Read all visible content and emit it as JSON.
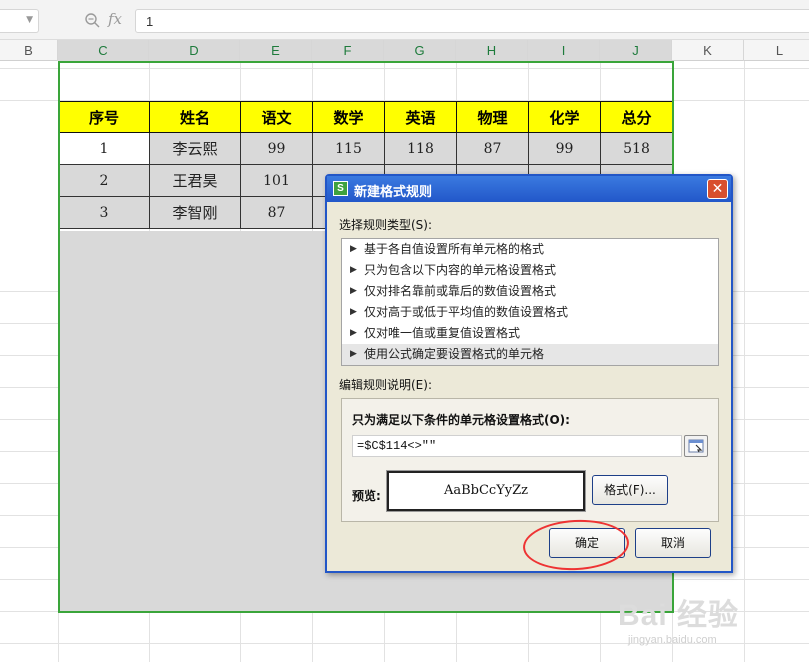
{
  "formula_bar": {
    "formula_value": "1"
  },
  "columns": [
    "B",
    "C",
    "D",
    "E",
    "F",
    "G",
    "H",
    "I",
    "J",
    "K",
    "L"
  ],
  "table": {
    "headers": [
      "序号",
      "姓名",
      "语文",
      "数学",
      "英语",
      "物理",
      "化学",
      "总分"
    ],
    "rows": [
      [
        "1",
        "李云熙",
        "99",
        "115",
        "118",
        "87",
        "99",
        "518"
      ],
      [
        "2",
        "王君昊",
        "101",
        "",
        "",
        "",
        "",
        ""
      ],
      [
        "3",
        "李智刚",
        "87",
        "",
        "",
        "",
        "",
        ""
      ]
    ]
  },
  "dialog": {
    "title": "新建格式规则",
    "rule_type_label": "选择规则类型(S):",
    "rule_types": [
      "基于各自值设置所有单元格的格式",
      "只为包含以下内容的单元格设置格式",
      "仅对排名靠前或靠后的数值设置格式",
      "仅对高于或低于平均值的数值设置格式",
      "仅对唯一值或重复值设置格式",
      "使用公式确定要设置格式的单元格"
    ],
    "selected_rule_index": 5,
    "edit_label": "编辑规则说明(E):",
    "condition_label": "只为满足以下条件的单元格设置格式(O):",
    "formula": "=$C$114<>\"\"",
    "preview_label": "预览:",
    "preview_text": "AaBbCcYyZz",
    "format_button": "格式(F)...",
    "ok_button": "确定",
    "cancel_button": "取消"
  },
  "watermark": {
    "text": "Bai 经验",
    "sub": "jingyan.baidu.com"
  }
}
